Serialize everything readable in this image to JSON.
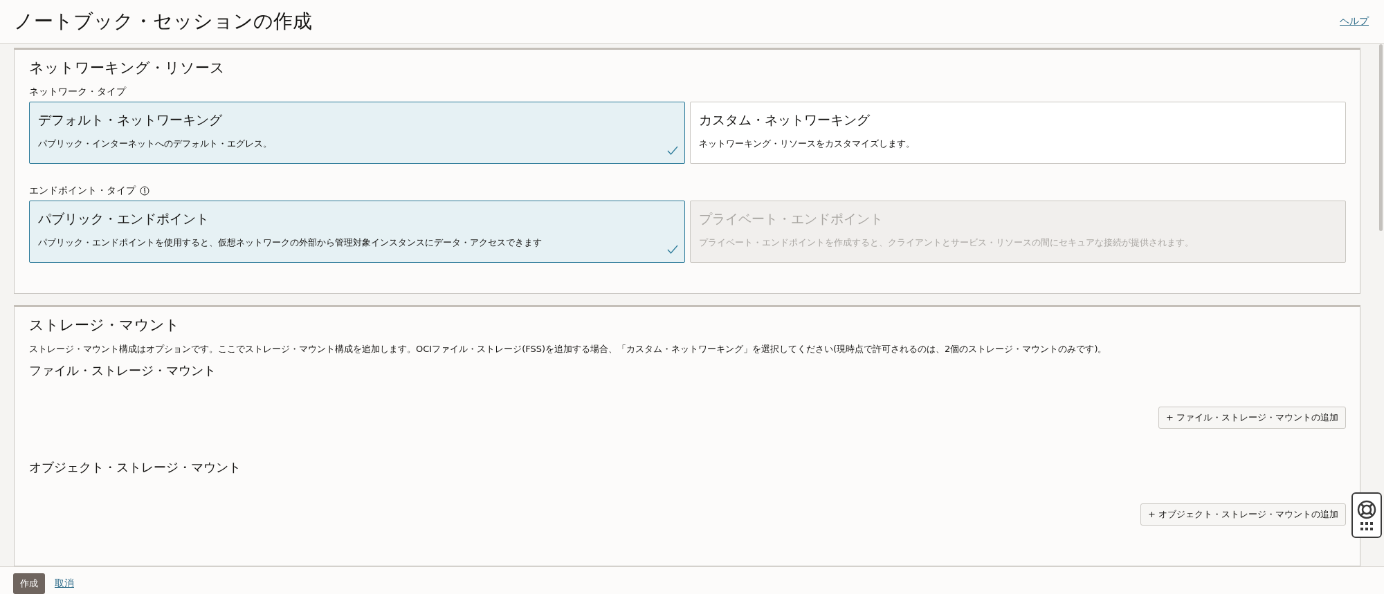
{
  "header": {
    "title": "ノートブック・セッションの作成",
    "help_link": "ヘルプ"
  },
  "networking": {
    "title": "ネットワーキング・リソース",
    "groups": [
      {
        "label": "ネットワーク・タイプ",
        "info": false,
        "options": [
          {
            "title": "デフォルト・ネットワーキング",
            "description": "パブリック・インターネットへのデフォルト・エグレス。",
            "selected": true,
            "disabled": false
          },
          {
            "title": "カスタム・ネットワーキング",
            "description": "ネットワーキング・リソースをカスタマイズします。",
            "selected": false,
            "disabled": false
          }
        ]
      },
      {
        "label": "エンドポイント・タイプ",
        "info": true,
        "options": [
          {
            "title": "パブリック・エンドポイント",
            "description": "パブリック・エンドポイントを使用すると、仮想ネットワークの外部から管理対象インスタンスにデータ・アクセスできます",
            "selected": true,
            "disabled": false
          },
          {
            "title": "プライベート・エンドポイント",
            "description": "プライベート・エンドポイントを作成すると、クライアントとサービス・リソースの間にセキュアな接続が提供されます。",
            "selected": false,
            "disabled": true
          }
        ]
      }
    ]
  },
  "storage": {
    "title": "ストレージ・マウント",
    "description": "ストレージ・マウント構成はオプションです。ここでストレージ・マウント構成を追加します。OCIファイル・ストレージ(FSS)を追加する場合、「カスタム・ネットワーキング」を選択してください(現時点で許可されるのは、2個のストレージ・マウントのみです)。",
    "subsections": [
      {
        "title": "ファイル・ストレージ・マウント",
        "button": "+ ファイル・ストレージ・マウントの追加"
      },
      {
        "title": "オブジェクト・ストレージ・マウント",
        "button": "+ オブジェクト・ストレージ・マウントの追加"
      }
    ]
  },
  "footer": {
    "create_button": "作成",
    "cancel_link": "取消"
  }
}
